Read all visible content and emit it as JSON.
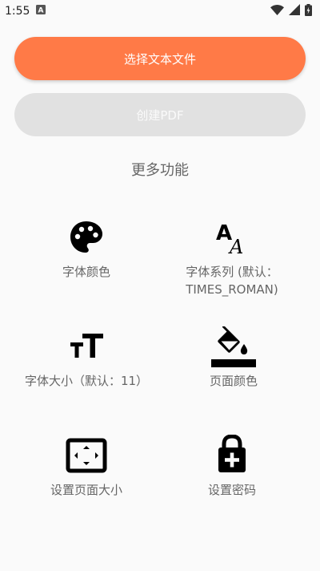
{
  "status_bar": {
    "time": "1:55",
    "notification_icon": "a-box-icon",
    "wifi_icon": "wifi-icon",
    "signal_icon": "signal-icon",
    "battery_icon": "battery-charging-icon"
  },
  "actions": {
    "select_file": "选择文本文件",
    "create_pdf": "创建PDF"
  },
  "colors": {
    "accent": "#ff7a47",
    "disabled": "#e1e1e1"
  },
  "section": {
    "title": "更多功能"
  },
  "features": [
    {
      "label": "字体颜色",
      "icon": "palette-icon"
    },
    {
      "label": "字体系列 (默认：TIMES_ROMAN)",
      "icon": "font-family-icon"
    },
    {
      "label": "字体大小（默认：11）",
      "icon": "text-size-icon"
    },
    {
      "label": "页面颜色",
      "icon": "paint-bucket-icon"
    },
    {
      "label": "设置页面大小",
      "icon": "page-size-icon"
    },
    {
      "label": "设置密码",
      "icon": "lock-add-icon"
    }
  ]
}
